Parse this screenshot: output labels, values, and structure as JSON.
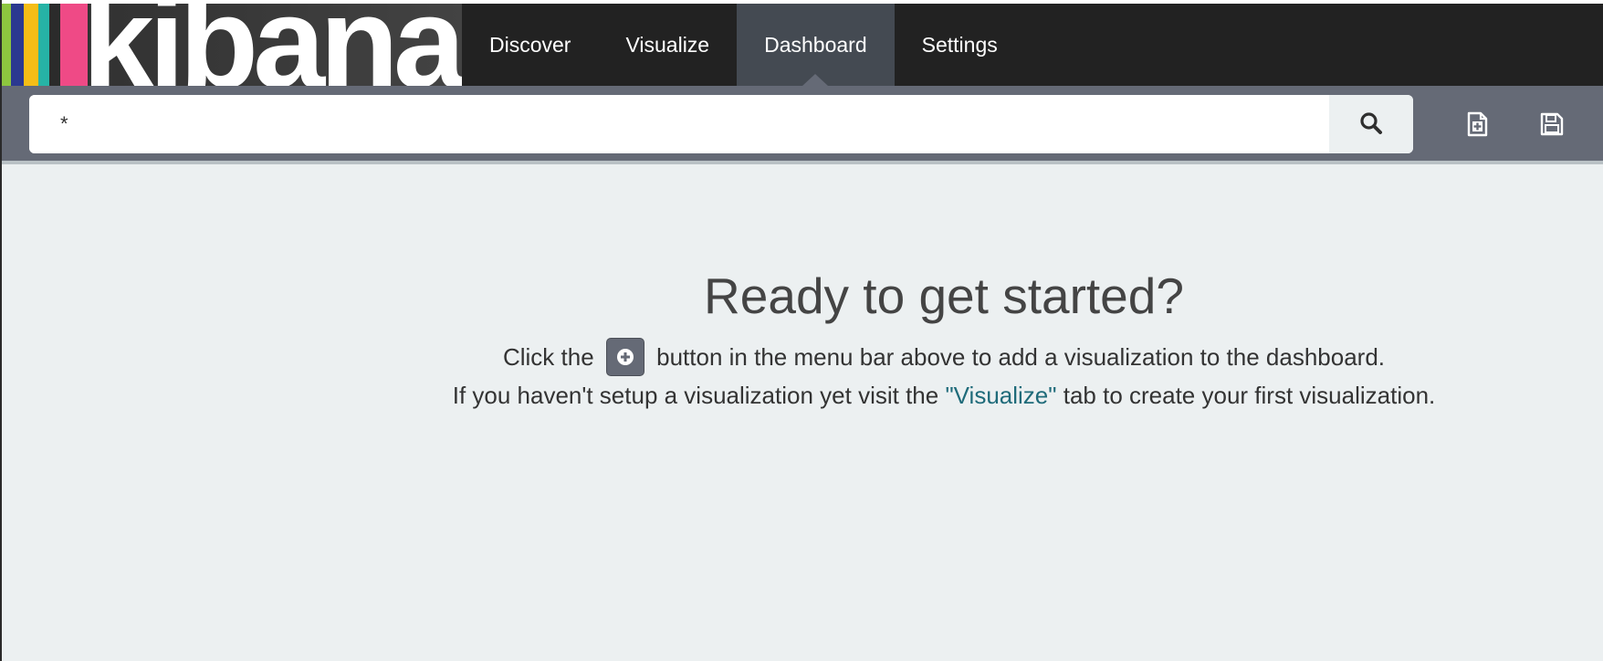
{
  "brand": {
    "name": "kibana",
    "stripe_colors": [
      "#8dc63f",
      "#2b3990",
      "#f5bd16",
      "#26b3a6",
      "#2b2b2b",
      "#ef4a86"
    ]
  },
  "nav": {
    "items": [
      {
        "label": "Discover"
      },
      {
        "label": "Visualize"
      },
      {
        "label": "Dashboard",
        "active": true
      },
      {
        "label": "Settings"
      }
    ]
  },
  "search": {
    "value": "*",
    "button_icon": "search-icon"
  },
  "toolbar": {
    "new_dashboard_icon": "new-dashboard-icon",
    "save_icon": "save-icon"
  },
  "empty_state": {
    "title": "Ready to get started?",
    "line1_prefix": "Click the",
    "line1_suffix": "button in the menu bar above to add a visualization to the dashboard.",
    "line2_prefix": "If you haven't setup a visualization yet visit the",
    "line2_link": "\"Visualize\"",
    "line2_suffix": "tab to create your first visualization.",
    "add_icon": "plus-circle-icon"
  },
  "colors": {
    "navbar": "#222222",
    "active_tab": "#444a52",
    "search_band": "#656a76",
    "page_background": "#ecf0f1",
    "link": "#1f6b7a"
  }
}
